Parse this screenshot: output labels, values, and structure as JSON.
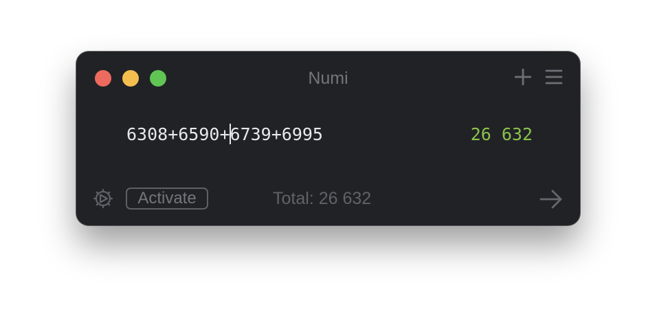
{
  "window": {
    "title": "Numi",
    "background": "#212226"
  },
  "titlebar": {
    "buttons": [
      {
        "name": "close",
        "color": "#ed6a5e"
      },
      {
        "name": "minimize",
        "color": "#f5bf4f"
      },
      {
        "name": "zoom",
        "color": "#61c554"
      }
    ],
    "actions": [
      "plus-icon",
      "hamburger-menu-icon"
    ]
  },
  "editor": {
    "line_before_caret": "6308+6590+",
    "line_after_caret": "6739+6995",
    "result": "26 632",
    "result_color": "#8bc34a"
  },
  "footer": {
    "settings_icon": "gear-icon",
    "activate_label": "Activate",
    "total_label": "Total: 26 632",
    "arrow_icon": "arrow-right-icon"
  }
}
